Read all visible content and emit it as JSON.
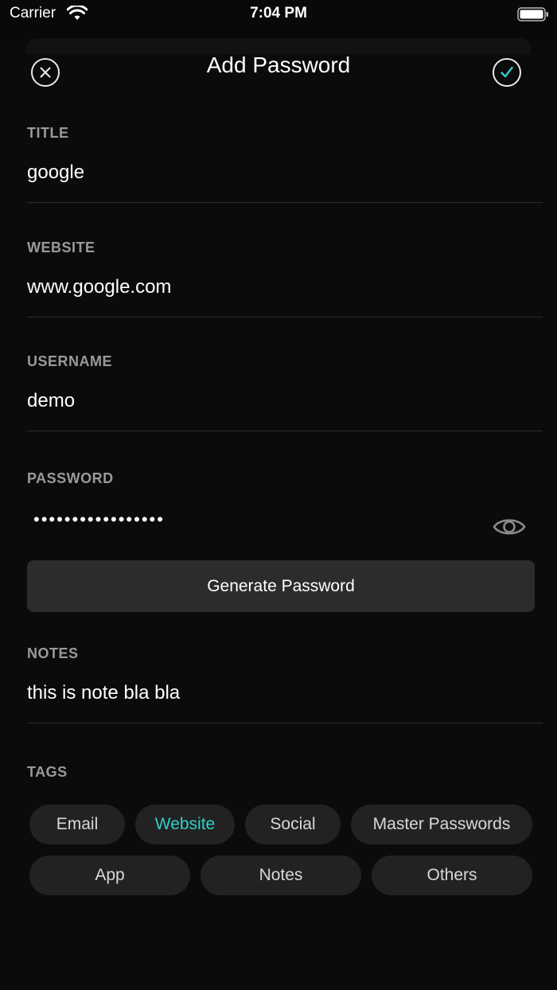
{
  "status_bar": {
    "carrier": "Carrier",
    "time": "7:04 PM"
  },
  "nav": {
    "title": "Add Password",
    "close_icon": "close-circle-icon",
    "done_icon": "checkmark-circle-icon"
  },
  "fields": {
    "title": {
      "label": "TITLE",
      "value": "google"
    },
    "website": {
      "label": "WEBSITE",
      "value": "www.google.com"
    },
    "username": {
      "label": "USERNAME",
      "value": "demo"
    },
    "password": {
      "label": "PASSWORD",
      "value": "•••••••••••••••••"
    },
    "notes": {
      "label": "NOTES",
      "value": "this is note bla bla"
    }
  },
  "generate_button": "Generate Password",
  "tags": {
    "label": "TAGS",
    "items": [
      "Email",
      "Website",
      "Social",
      "Master Passwords",
      "App",
      "Notes",
      "Others"
    ],
    "selected": "Website"
  },
  "colors": {
    "accent": "#2fd0c6",
    "background": "#090909",
    "chip": "#222222",
    "button": "#2b2c2e"
  }
}
